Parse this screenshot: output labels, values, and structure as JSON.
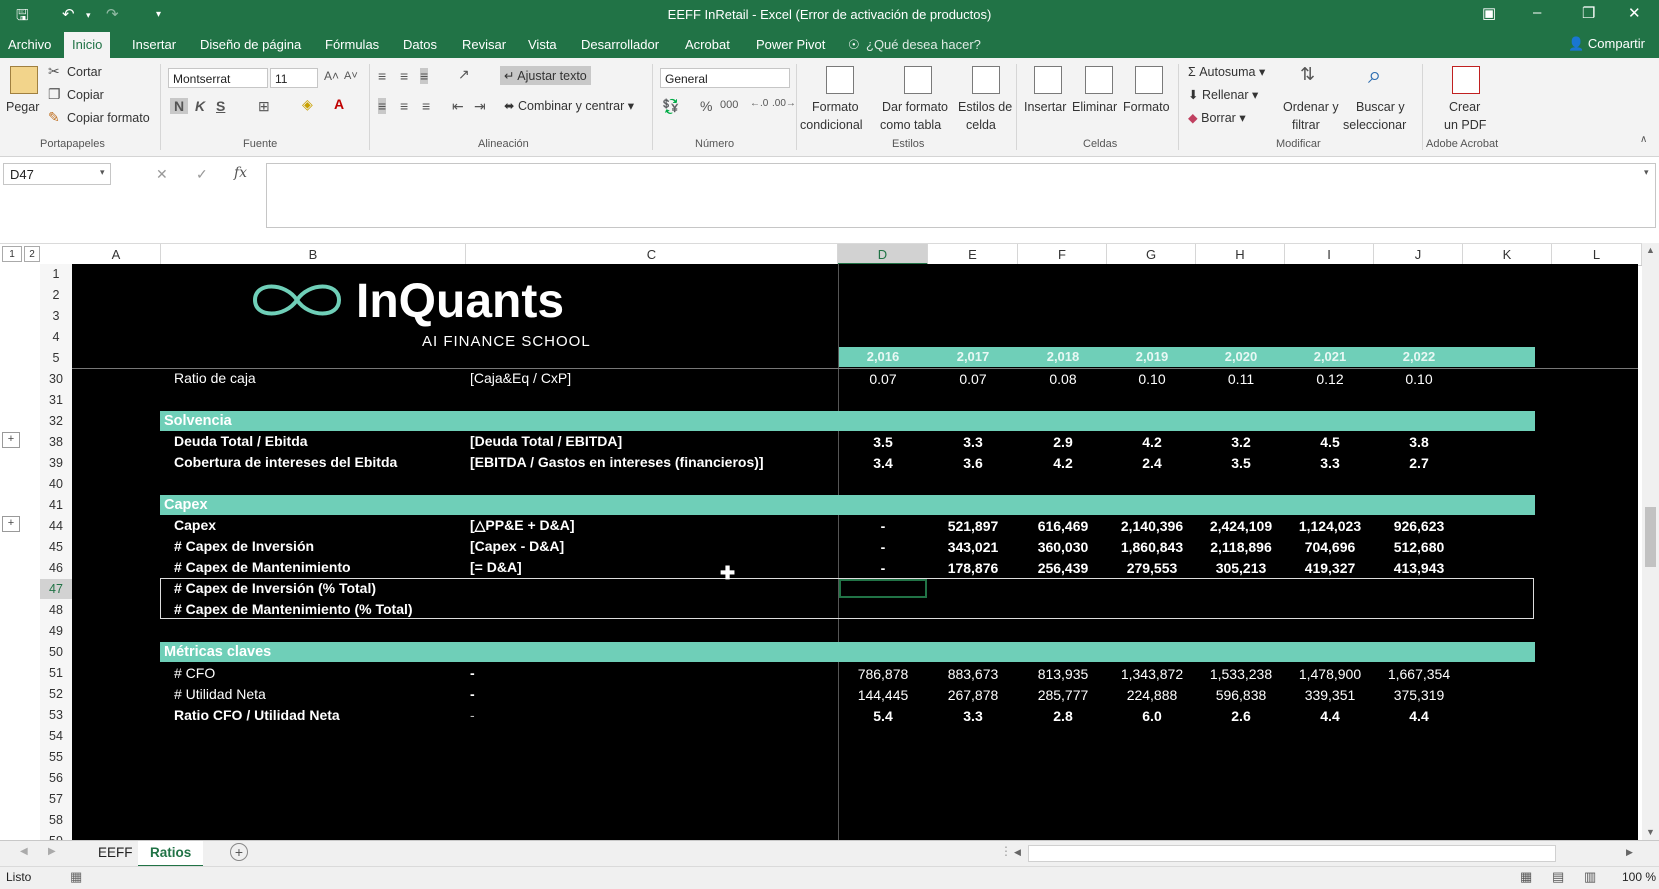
{
  "window": {
    "title": "EEFF InRetail - Excel (Error de activación de productos)"
  },
  "tabs": [
    "Archivo",
    "Inicio",
    "Insertar",
    "Diseño de página",
    "Fórmulas",
    "Datos",
    "Revisar",
    "Vista",
    "Desarrollador",
    "Acrobat",
    "Power Pivot"
  ],
  "active_tab": "Inicio",
  "tell_me": "¿Qué desea hacer?",
  "share": "Compartir",
  "ribbon": {
    "clipboard": {
      "paste": "Pegar",
      "cut": "Cortar",
      "copy": "Copiar",
      "format_painter": "Copiar formato",
      "group": "Portapapeles"
    },
    "font": {
      "family": "Montserrat",
      "size": "11",
      "bold": "N",
      "italic": "K",
      "underline": "S",
      "group": "Fuente"
    },
    "alignment": {
      "wrap": "Ajustar texto",
      "merge": "Combinar y centrar",
      "group": "Alineación"
    },
    "number": {
      "format": "General",
      "group": "Número"
    },
    "styles": {
      "conditional_1": "Formato",
      "conditional_2": "condicional",
      "table_1": "Dar formato",
      "table_2": "como tabla",
      "cell_1": "Estilos de",
      "cell_2": "celda",
      "group": "Estilos"
    },
    "cells": {
      "insert": "Insertar",
      "delete": "Eliminar",
      "format": "Formato",
      "group": "Celdas"
    },
    "editing": {
      "autosum": "Autosuma",
      "fill": "Rellenar",
      "clear": "Borrar",
      "sort_1": "Ordenar y",
      "sort_2": "filtrar",
      "find_1": "Buscar y",
      "find_2": "seleccionar",
      "group": "Modificar"
    },
    "acrobat": {
      "create_1": "Crear",
      "create_2": "un PDF",
      "group": "Adobe Acrobat"
    }
  },
  "formula_bar": {
    "name_box": "D47",
    "fx": "fx",
    "value": ""
  },
  "columns": [
    "A",
    "B",
    "C",
    "D",
    "E",
    "F",
    "G",
    "H",
    "I",
    "J",
    "K",
    "L"
  ],
  "rows": [
    "1",
    "2",
    "3",
    "4",
    "5",
    "30",
    "31",
    "32",
    "38",
    "39",
    "40",
    "41",
    "44",
    "45",
    "46",
    "47",
    "48",
    "49",
    "50",
    "51",
    "52",
    "53",
    "54",
    "55",
    "56",
    "57",
    "58",
    "59"
  ],
  "outline_levels": [
    "1",
    "2"
  ],
  "logo": {
    "name": "InQuants",
    "tagline": "AI FINANCE SCHOOL"
  },
  "years": [
    "2,016",
    "2,017",
    "2,018",
    "2,019",
    "2,020",
    "2,021",
    "2,022"
  ],
  "sections": {
    "solvencia": "Solvencia",
    "capex": "Capex",
    "metricas": "Métricas claves"
  },
  "lines": {
    "caja": {
      "label": "Ratio de caja",
      "formula": "[Caja&Eq / CxP]",
      "values": [
        "0.07",
        "0.07",
        "0.08",
        "0.10",
        "0.11",
        "0.12",
        "0.10"
      ]
    },
    "deuda": {
      "label": "Deuda Total / Ebitda",
      "formula": "[Deuda Total / EBITDA]",
      "values": [
        "3.5",
        "3.3",
        "2.9",
        "4.2",
        "3.2",
        "4.5",
        "3.8"
      ]
    },
    "cobertura": {
      "label": "Cobertura de intereses del Ebitda",
      "formula": "[EBITDA / Gastos en intereses (financieros)]",
      "values": [
        "3.4",
        "3.6",
        "4.2",
        "2.4",
        "3.5",
        "3.3",
        "2.7"
      ]
    },
    "capex": {
      "label": "Capex",
      "formula": "[△PP&E + D&A]",
      "values": [
        "-",
        "521,897",
        "616,469",
        "2,140,396",
        "2,424,109",
        "1,124,023",
        "926,623"
      ]
    },
    "inversion": {
      "label": "# Capex de Inversión",
      "formula": "[Capex - D&A]",
      "values": [
        "-",
        "343,021",
        "360,030",
        "1,860,843",
        "2,118,896",
        "704,696",
        "512,680"
      ]
    },
    "mantenimiento": {
      "label": "# Capex de Mantenimiento",
      "formula": "[= D&A]",
      "values": [
        "-",
        "178,876",
        "256,439",
        "279,553",
        "305,213",
        "419,327",
        "413,943"
      ]
    },
    "inv_pct": {
      "label": "# Capex de Inversión (% Total)"
    },
    "mant_pct": {
      "label": "# Capex de Mantenimiento (% Total)"
    },
    "cfo": {
      "label": "# CFO",
      "formula": "-",
      "values": [
        "786,878",
        "883,673",
        "813,935",
        "1,343,872",
        "1,533,238",
        "1,478,900",
        "1,667,354"
      ]
    },
    "utilidad": {
      "label": "# Utilidad Neta",
      "formula": "-",
      "values": [
        "144,445",
        "267,878",
        "285,777",
        "224,888",
        "596,838",
        "339,351",
        "375,319"
      ]
    },
    "ratio_cfo": {
      "label": "Ratio CFO / Utilidad Neta",
      "formula": "-",
      "values": [
        "5.4",
        "3.3",
        "2.8",
        "6.0",
        "2.6",
        "4.4",
        "4.4"
      ]
    }
  },
  "sheets": [
    "EEFF",
    "Ratios"
  ],
  "active_sheet": "Ratios",
  "status": {
    "mode": "Listo",
    "zoom": "100 %"
  }
}
